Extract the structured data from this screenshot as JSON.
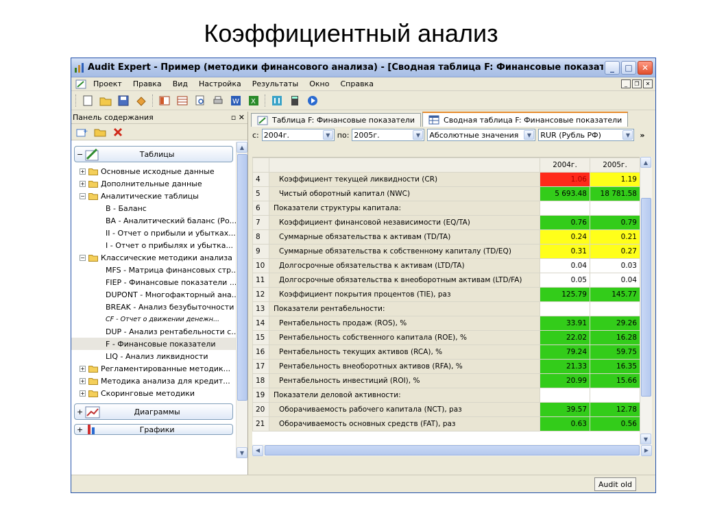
{
  "slide_title": "Коэффициентный анализ",
  "window": {
    "title": "Audit Expert - Пример (методики финансового анализа)  - [Сводная таблица F: Финансовые показатели]",
    "minimize": "_",
    "maximize": "□",
    "close": "✕"
  },
  "menu": [
    "Проект",
    "Правка",
    "Вид",
    "Настройка",
    "Результаты",
    "Окно",
    "Справка"
  ],
  "left_panel": {
    "header": "Панель содержания",
    "header_buttons": "▫ ✕",
    "groups": {
      "tables": "Таблицы",
      "charts": "Диаграммы",
      "charts2": "Графики"
    },
    "tree": [
      {
        "label": "Основные исходные данные",
        "level": 0,
        "expander": "+"
      },
      {
        "label": "Дополнительные данные",
        "level": 0,
        "expander": "+"
      },
      {
        "label": "Аналитические таблицы",
        "level": 0,
        "expander": "−"
      },
      {
        "label": "B - Баланс",
        "level": 1
      },
      {
        "label": "BA - Аналитический баланс (Ро...",
        "level": 1
      },
      {
        "label": "II - Отчет о прибыли и убытках...",
        "level": 1
      },
      {
        "label": "I - Отчет о прибылях и убытка...",
        "level": 1
      },
      {
        "label": "Классические методики анализа",
        "level": 0,
        "expander": "−"
      },
      {
        "label": "MFS - Матрица финансовых стр...",
        "level": 1
      },
      {
        "label": "FIEP - Финансовые показатели ...",
        "level": 1
      },
      {
        "label": "DUPONT - Многофакторный ана...",
        "level": 1
      },
      {
        "label": "BREAK - Анализ безубыточности",
        "level": 1
      },
      {
        "label": "CF - Отчет о движении денежн...",
        "level": 1
      },
      {
        "label": "DUP - Анализ рентабельности с...",
        "level": 1
      },
      {
        "label": "F - Финансовые показатели",
        "level": 1,
        "selected": true
      },
      {
        "label": "LIQ - Анализ ликвидности",
        "level": 1
      },
      {
        "label": "Регламентированные методик...",
        "level": 0,
        "expander": "+"
      },
      {
        "label": "Методика анализа для кредит...",
        "level": 0,
        "expander": "+"
      },
      {
        "label": "Скоринговые методики",
        "level": 0,
        "expander": "+"
      }
    ]
  },
  "tabs": [
    {
      "label": "Таблица F: Финансовые показатели",
      "active": false
    },
    {
      "label": "Сводная таблица F: Финансовые показатели",
      "active": true
    }
  ],
  "filters": {
    "from_label": "с:",
    "from_value": "2004г.",
    "to_label": "по:",
    "to_value": "2005г.",
    "mode_value": "Абсолютные значения",
    "currency_value": "RUR (Рубль РФ)",
    "more": "»"
  },
  "table": {
    "columns": [
      "",
      "",
      "2004г.",
      "2005г."
    ],
    "rows": [
      {
        "num": "4",
        "name": "Коэффициент текущей ликвидности (CR)",
        "v1": "1.06",
        "c1": "red",
        "v2": "1.19",
        "c2": "yellow",
        "indent": true
      },
      {
        "num": "5",
        "name": "Чистый оборотный капитал (NWC)",
        "v1": "5 693.48",
        "c1": "green",
        "v2": "18 781.58",
        "c2": "green",
        "indent": true
      },
      {
        "num": "6",
        "name": "Показатели структуры капитала:",
        "v1": "",
        "c1": "",
        "v2": "",
        "c2": "",
        "indent": false
      },
      {
        "num": "7",
        "name": "Коэффициент финансовой независимости (EQ/TA)",
        "v1": "0.76",
        "c1": "green",
        "v2": "0.79",
        "c2": "green",
        "indent": true
      },
      {
        "num": "8",
        "name": "Суммарные обязательства к активам (TD/TA)",
        "v1": "0.24",
        "c1": "yellow",
        "v2": "0.21",
        "c2": "yellow",
        "indent": true
      },
      {
        "num": "9",
        "name": "Суммарные обязательства к собственному капиталу (TD/EQ)",
        "v1": "0.31",
        "c1": "yellow",
        "v2": "0.27",
        "c2": "yellow",
        "indent": true
      },
      {
        "num": "10",
        "name": "Долгосрочные обязательства к активам (LTD/TA)",
        "v1": "0.04",
        "c1": "",
        "v2": "0.03",
        "c2": "",
        "indent": true
      },
      {
        "num": "11",
        "name": "Долгосрочные обязательства к внеоборотным активам (LTD/FA)",
        "v1": "0.05",
        "c1": "",
        "v2": "0.04",
        "c2": "",
        "indent": true
      },
      {
        "num": "12",
        "name": "Коэффициент покрытия процентов (TIE), раз",
        "v1": "125.79",
        "c1": "green",
        "v2": "145.77",
        "c2": "green",
        "indent": true
      },
      {
        "num": "13",
        "name": "Показатели рентабельности:",
        "v1": "",
        "c1": "",
        "v2": "",
        "c2": "",
        "indent": false
      },
      {
        "num": "14",
        "name": "Рентабельность продаж (ROS), %",
        "v1": "33.91",
        "c1": "green",
        "v2": "29.26",
        "c2": "green",
        "indent": true
      },
      {
        "num": "15",
        "name": "Рентабельность собственного капитала (ROE), %",
        "v1": "22.02",
        "c1": "green",
        "v2": "16.28",
        "c2": "green",
        "indent": true
      },
      {
        "num": "16",
        "name": "Рентабельность текущих активов (RCA), %",
        "v1": "79.24",
        "c1": "green",
        "v2": "59.75",
        "c2": "green",
        "indent": true
      },
      {
        "num": "17",
        "name": "Рентабельность внеоборотных активов (RFA), %",
        "v1": "21.33",
        "c1": "green",
        "v2": "16.35",
        "c2": "green",
        "indent": true
      },
      {
        "num": "18",
        "name": "Рентабельность инвестиций (ROI), %",
        "v1": "20.99",
        "c1": "green",
        "v2": "15.66",
        "c2": "green",
        "indent": true
      },
      {
        "num": "19",
        "name": "Показатели деловой активности:",
        "v1": "",
        "c1": "",
        "v2": "",
        "c2": "",
        "indent": false
      },
      {
        "num": "20",
        "name": "Оборачиваемость рабочего капитала (NCT), раз",
        "v1": "39.57",
        "c1": "green",
        "v2": "12.78",
        "c2": "green",
        "indent": true
      },
      {
        "num": "21",
        "name": "Оборачиваемость основных средств (FAT), раз",
        "v1": "0.63",
        "c1": "green",
        "v2": "0.56",
        "c2": "green",
        "indent": true
      }
    ]
  },
  "status": {
    "button": "Audit old"
  }
}
